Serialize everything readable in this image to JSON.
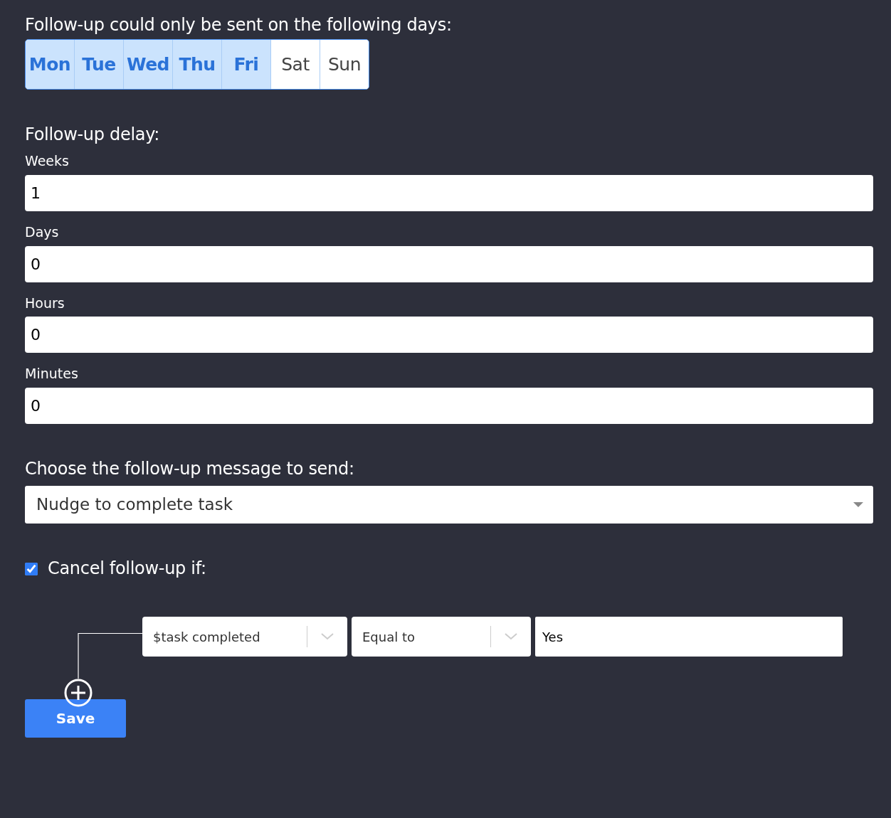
{
  "days_title": "Follow-up could only be sent on the following days:",
  "days": [
    {
      "label": "Mon",
      "selected": true
    },
    {
      "label": "Tue",
      "selected": true
    },
    {
      "label": "Wed",
      "selected": true
    },
    {
      "label": "Thu",
      "selected": true
    },
    {
      "label": "Fri",
      "selected": true
    },
    {
      "label": "Sat",
      "selected": false
    },
    {
      "label": "Sun",
      "selected": false
    }
  ],
  "delay_title": "Follow-up delay:",
  "delay_fields": [
    {
      "label": "Weeks",
      "value": "1"
    },
    {
      "label": "Days",
      "value": "0"
    },
    {
      "label": "Hours",
      "value": "0"
    },
    {
      "label": "Minutes",
      "value": "0"
    }
  ],
  "message_title": "Choose the follow-up message to send:",
  "message_select": {
    "value": "Nudge to complete task"
  },
  "cancel": {
    "label": "Cancel follow-up if:",
    "checked": true
  },
  "condition": {
    "variable": "$task completed",
    "operator": "Equal to",
    "value": "Yes"
  },
  "save_button": "Save"
}
